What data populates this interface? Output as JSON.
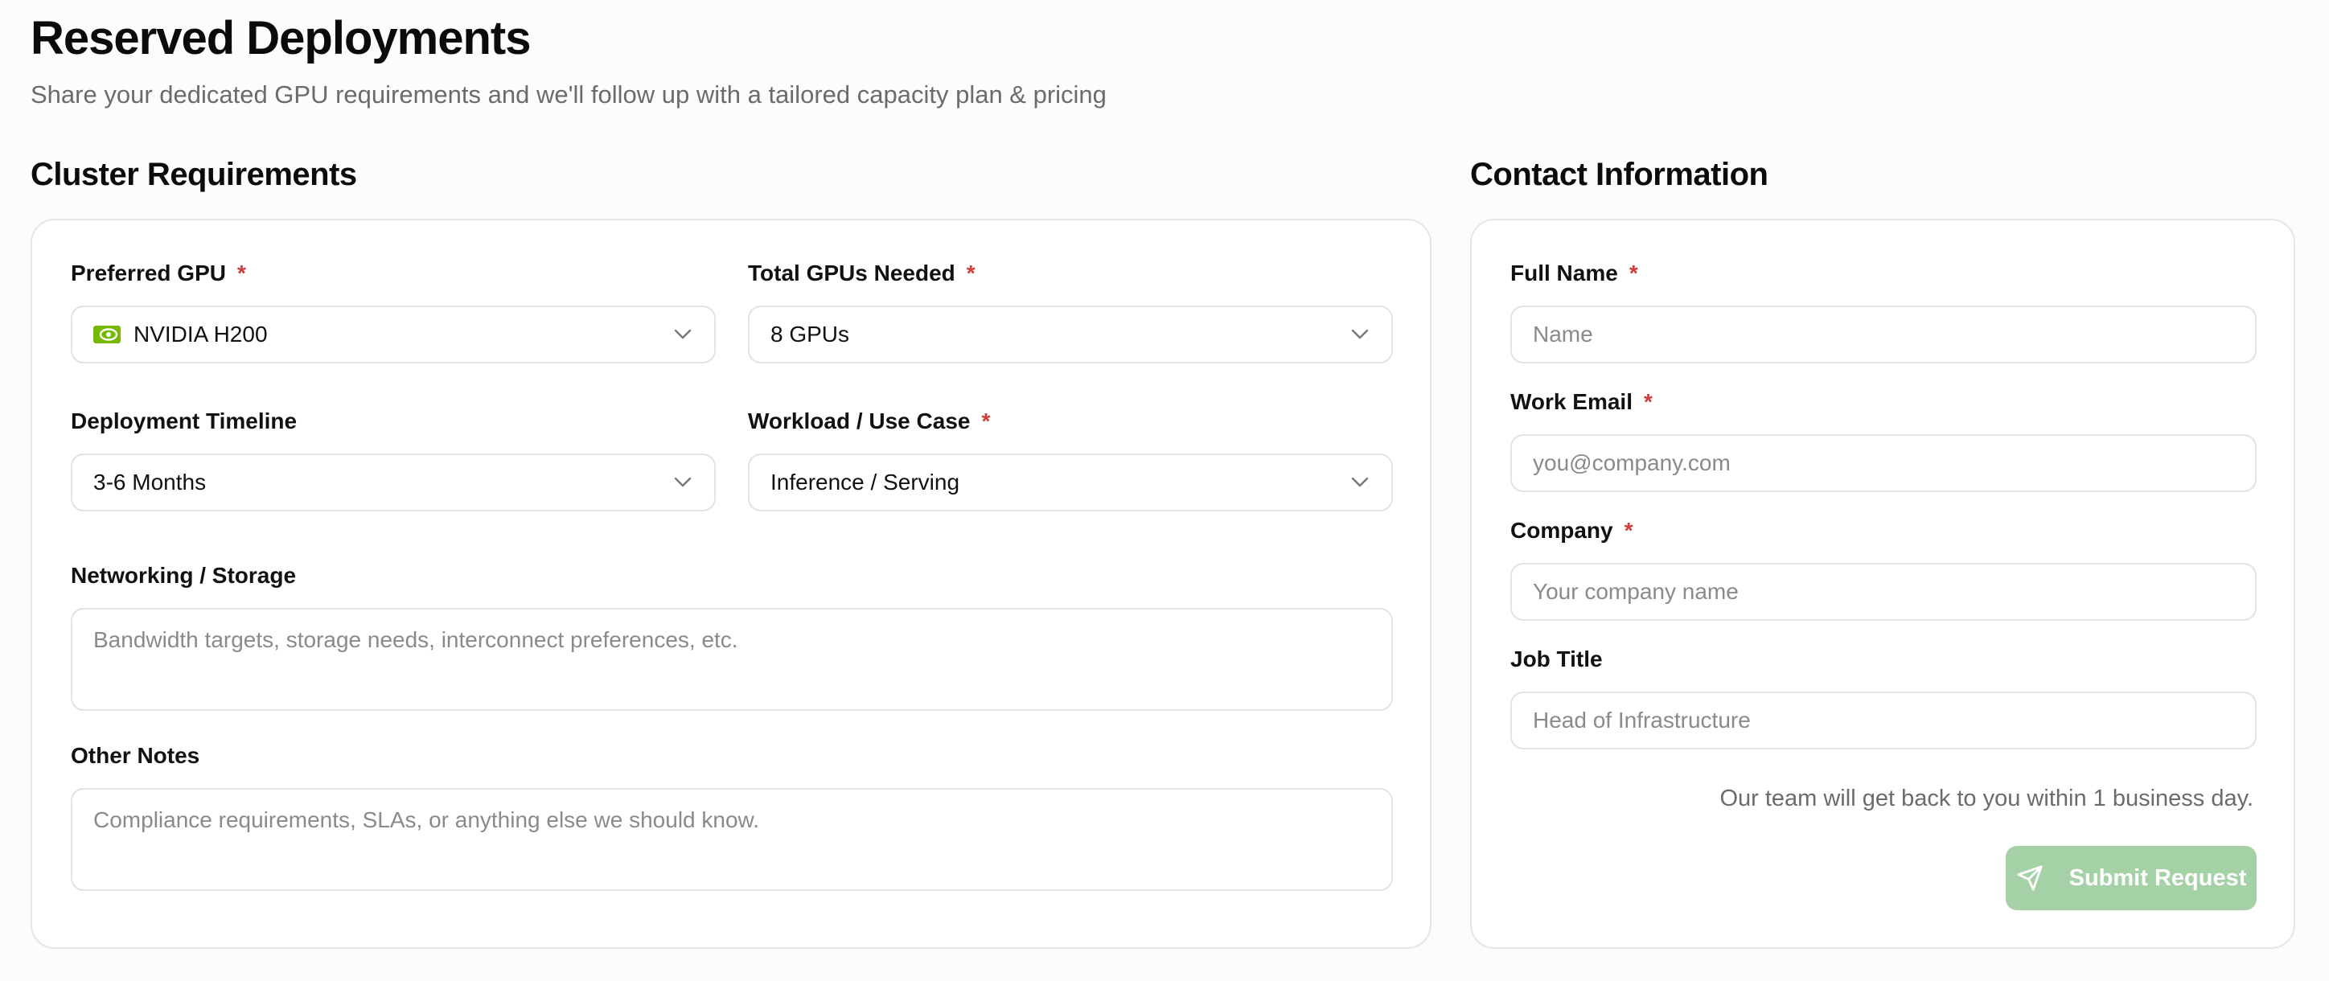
{
  "header": {
    "title": "Reserved Deployments",
    "subtitle": "Share your dedicated GPU requirements and we'll follow up with a tailored capacity plan & pricing"
  },
  "cluster": {
    "section_title": "Cluster Requirements",
    "preferred_gpu": {
      "label": "Preferred GPU",
      "value": "NVIDIA H200",
      "icon": "nvidia-logo-icon",
      "required": "*"
    },
    "total_gpus": {
      "label": "Total GPUs Needed",
      "value": "8 GPUs",
      "required": "*"
    },
    "timeline": {
      "label": "Deployment Timeline",
      "value": "3-6 Months"
    },
    "workload": {
      "label": "Workload / Use Case",
      "value": "Inference / Serving",
      "required": "*"
    },
    "networking": {
      "label": "Networking / Storage",
      "placeholder": "Bandwidth targets, storage needs, interconnect preferences, etc."
    },
    "notes": {
      "label": "Other Notes",
      "placeholder": "Compliance requirements, SLAs, or anything else we should know."
    }
  },
  "contact": {
    "section_title": "Contact Information",
    "full_name": {
      "label": "Full Name",
      "placeholder": "Name",
      "required": "*"
    },
    "work_email": {
      "label": "Work Email",
      "placeholder": "you@company.com",
      "required": "*"
    },
    "company": {
      "label": "Company",
      "placeholder": "Your company name",
      "required": "*"
    },
    "job_title": {
      "label": "Job Title",
      "placeholder": "Head of Infrastructure"
    },
    "note": "Our team will get back to you within 1 business day.",
    "submit_label": "Submit Request",
    "submit_icon": "send-icon"
  },
  "colors": {
    "accent": "#a5d1a7",
    "required": "#d13b3b",
    "nvidia_green": "#76b900"
  }
}
